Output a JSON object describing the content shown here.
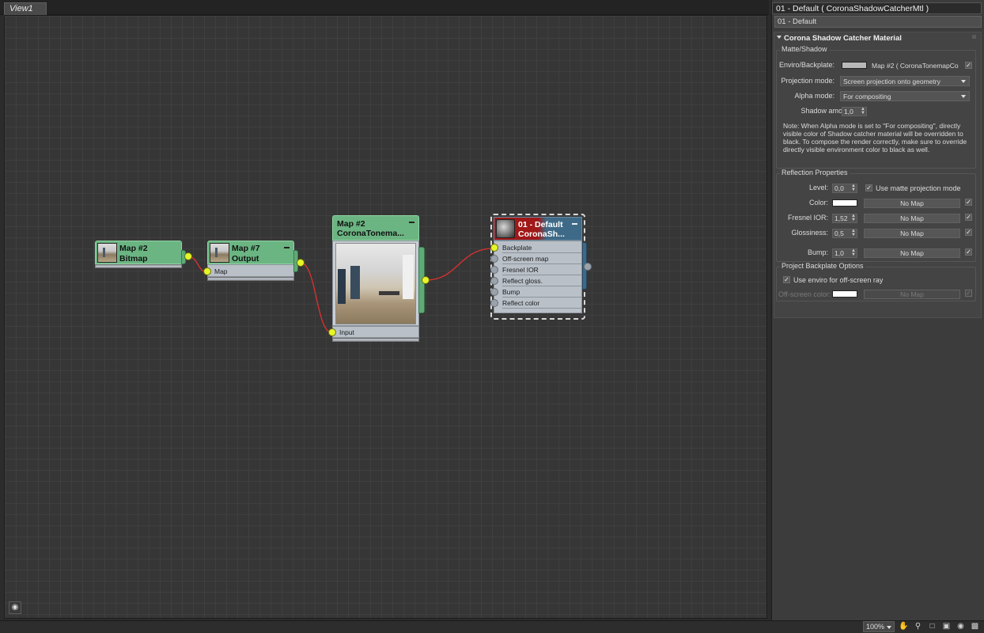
{
  "view": {
    "tab_label": "View1"
  },
  "nodes": {
    "bitmap": {
      "title1": "Map #2",
      "title2": "Bitmap"
    },
    "output": {
      "title1": "Map #7",
      "title2": "Output",
      "slot": "Map"
    },
    "tonemap": {
      "title1": "Map #2",
      "title2": "CoronaTonema...",
      "slot": "Input"
    },
    "material": {
      "title1": "01 - Default",
      "title2": "CoronaSh...",
      "slots": [
        "Backplate",
        "Off-screen map",
        "Fresnel IOR",
        "Reflect gloss.",
        "Bump",
        "Reflect color"
      ]
    }
  },
  "panel": {
    "title": "01 - Default  ( CoronaShadowCatcherMtl )",
    "name_field": "01 - Default",
    "rollout_title": "Corona Shadow Catcher Material",
    "matte": {
      "group_title": "Matte/Shadow",
      "enviro_label": "Enviro/Backplate:",
      "enviro_map": "Map #2  ( CoronaTonemapCo",
      "projection_label": "Projection mode:",
      "projection_value": "Screen projection onto geometry",
      "alpha_label": "Alpha mode:",
      "alpha_value": "For compositing",
      "shadow_label": "Shadow amount:",
      "shadow_value": "1,0",
      "note": [
        "Note: When Alpha mode is set to \"For compositing\", directly",
        "visible color of Shadow catcher material will be overridden to",
        "black. To compose the render correctly, make sure to override",
        "directly visible environment color to black as well."
      ]
    },
    "reflection": {
      "group_title": "Reflection Properties",
      "level_label": "Level:",
      "level_value": "0,0",
      "use_matte_label": "Use matte projection mode",
      "color_label": "Color:",
      "fresnel_label": "Fresnel IOR:",
      "fresnel_value": "1,52",
      "gloss_label": "Glossiness:",
      "gloss_value": "0,5",
      "bump_label": "Bump:",
      "bump_value": "1,0",
      "no_map": "No Map"
    },
    "backplate": {
      "group_title": "Project Backplate Options",
      "use_enviro_label": "Use enviro for off-screen ray",
      "offscreen_label": "Off-screen color:",
      "no_map": "No Map"
    }
  },
  "status": {
    "zoom": "100%"
  },
  "colors": {
    "node_green": "#6bb582",
    "material_red": "#a01818",
    "material_blue": "#3e6a88",
    "port_yellow": "#e6f52a",
    "wire_red": "#e03030"
  }
}
